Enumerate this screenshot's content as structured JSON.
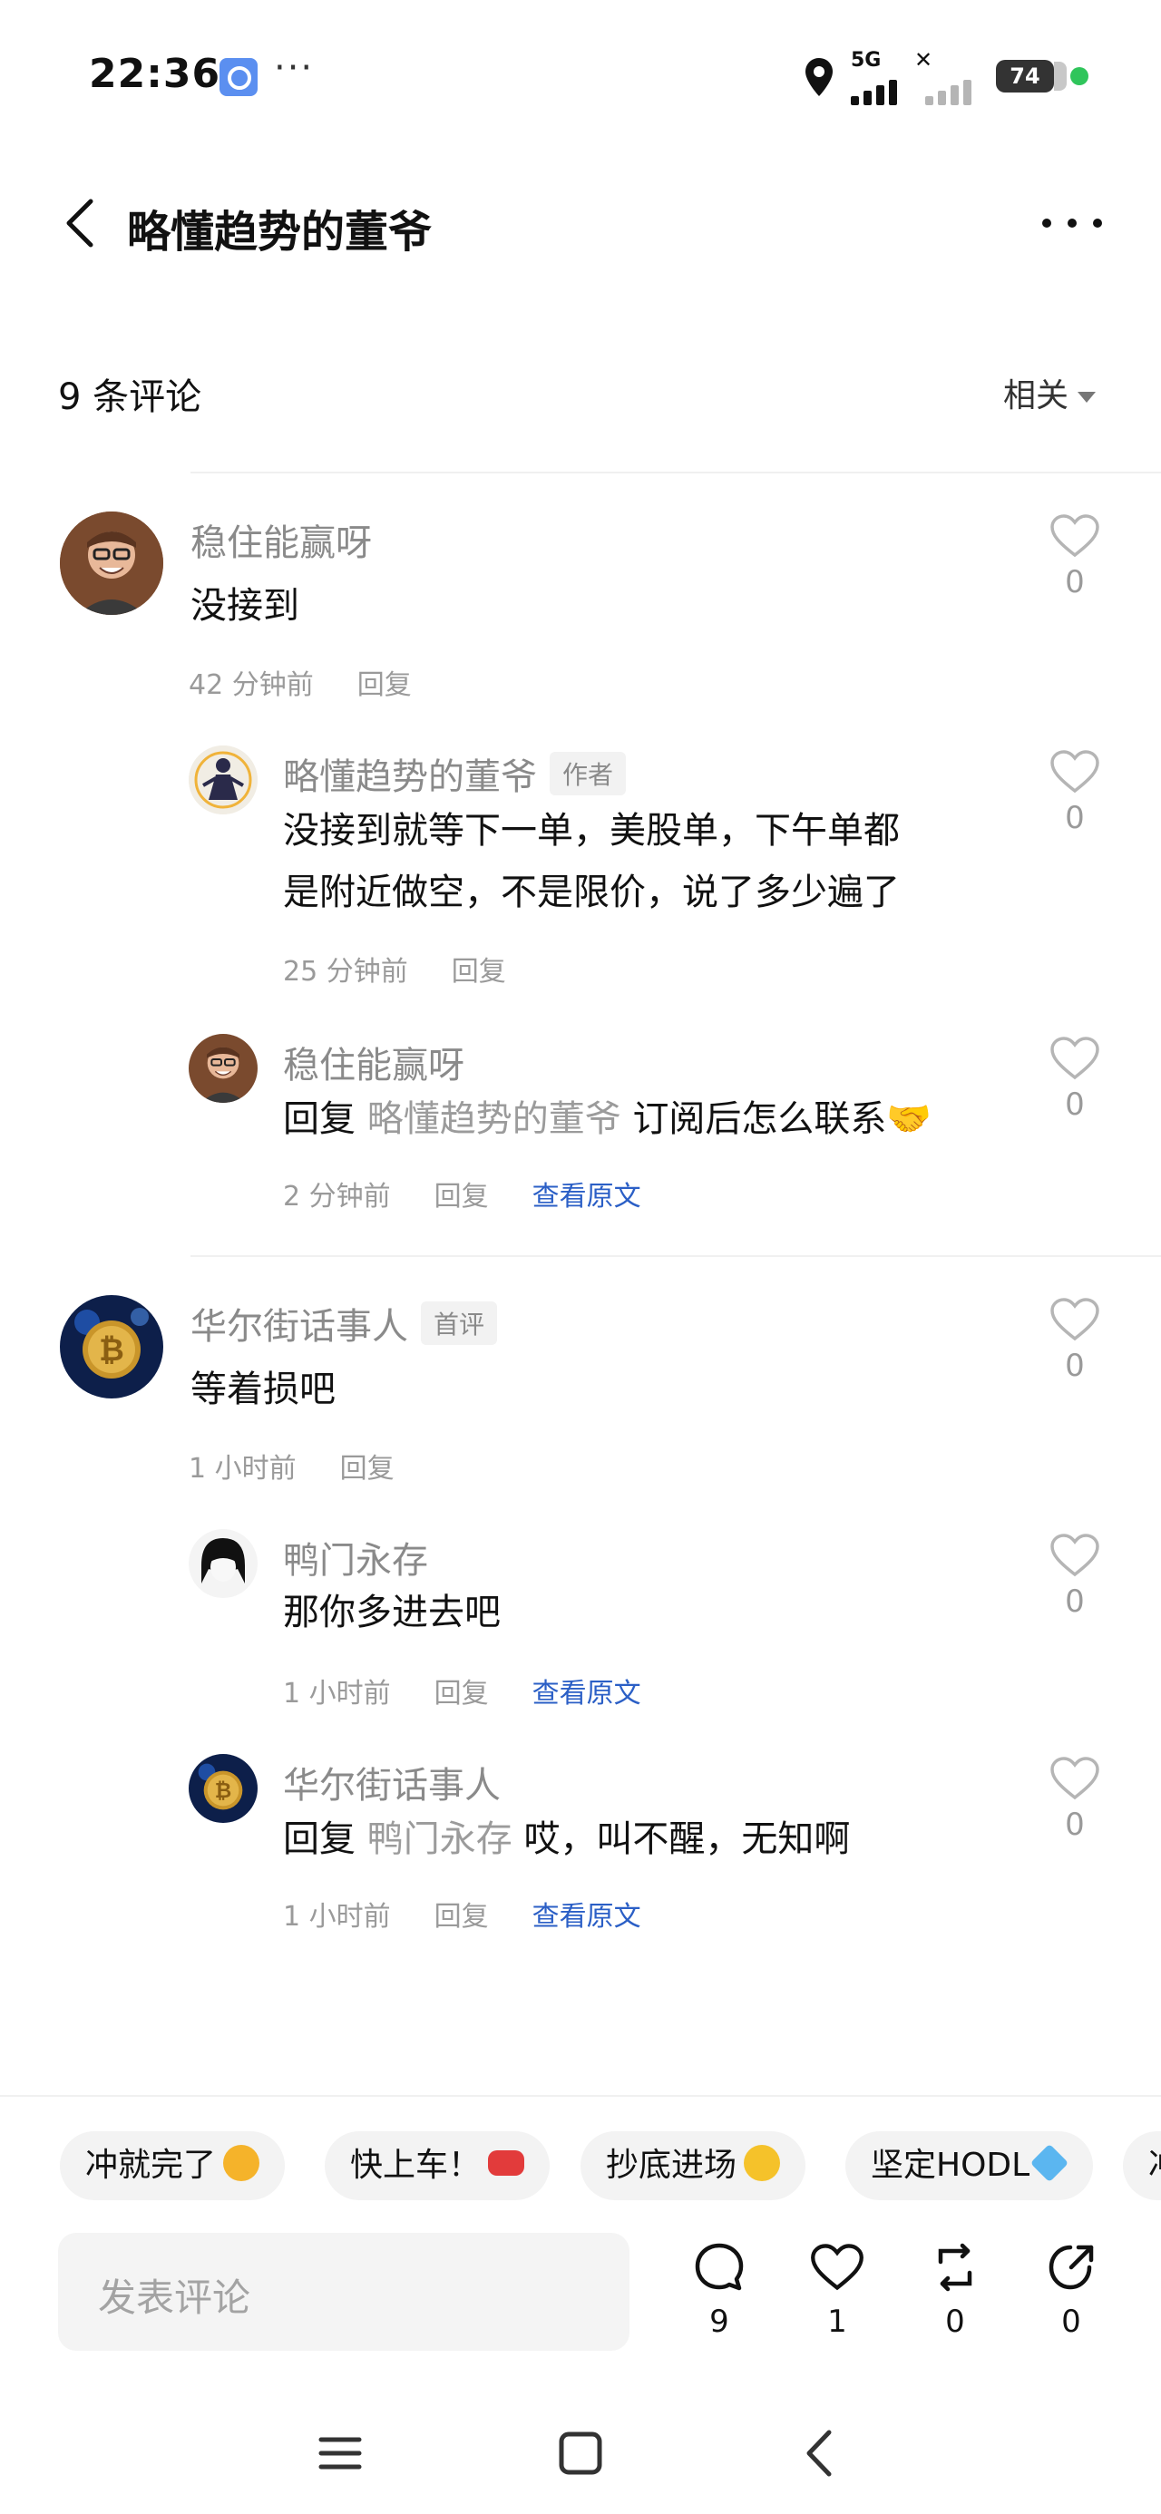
{
  "status_bar": {
    "time": "22:36",
    "more": "···",
    "network": "5G",
    "battery": "74"
  },
  "header": {
    "title": "略懂趋势的董爷"
  },
  "comments_header": {
    "count_label": "9 条评论",
    "sort_label": "相关"
  },
  "comments": [
    {
      "name": "稳住能赢呀",
      "text": "没接到",
      "time": "42 分钟前",
      "reply_label": "回复",
      "likes": "0",
      "replies": [
        {
          "name": "略懂趋势的董爷",
          "badge": "作者",
          "text_line1": "没接到就等下一单，美股单，下午单都",
          "text_line2": "是附近做空，不是限价，说了多少遍了",
          "time": "25 分钟前",
          "reply_label": "回复",
          "likes": "0"
        },
        {
          "name": "稳住能赢呀",
          "reply_prefix": "回复",
          "mention": "略懂趋势的董爷",
          "text": "订阅后怎么联系🤝",
          "time": "2 分钟前",
          "reply_label": "回复",
          "view_original": "查看原文",
          "likes": "0"
        }
      ]
    },
    {
      "name": "华尔街话事人",
      "badge": "首评",
      "text": "等着损吧",
      "time": "1 小时前",
      "reply_label": "回复",
      "likes": "0",
      "replies": [
        {
          "name": "鸭门永存",
          "text": "那你多进去吧",
          "time": "1 小时前",
          "reply_label": "回复",
          "view_original": "查看原文",
          "likes": "0"
        },
        {
          "name": "华尔街话事人",
          "reply_prefix": "回复",
          "mention": "鸭门永存",
          "text": "哎，叫不醒，无知啊",
          "time": "1 小时前",
          "reply_label": "回复",
          "view_original": "查看原文",
          "likes": "0"
        }
      ]
    }
  ],
  "quick_replies": [
    {
      "label": "冲就完了",
      "emoji": "fist-emoji",
      "color": "#f5b32a"
    },
    {
      "label": "快上车！",
      "emoji": "car-emoji",
      "color": "#e23b3b"
    },
    {
      "label": "抄底进场",
      "emoji": "sunglasses-emoji",
      "color": "#f5c22a"
    },
    {
      "label": "坚定HODL",
      "emoji": "diamond-emoji",
      "color": "#5bb6f0"
    },
    {
      "label": "冲",
      "emoji": "",
      "color": ""
    }
  ],
  "bottom_bar": {
    "input_placeholder": "发表评论",
    "comment_count": "9",
    "like_count": "1",
    "repost_count": "0",
    "share_count": "0"
  },
  "colors": {
    "link": "#2b5fc6",
    "muted": "#8a8a8a",
    "status_green": "#2fc55b"
  }
}
